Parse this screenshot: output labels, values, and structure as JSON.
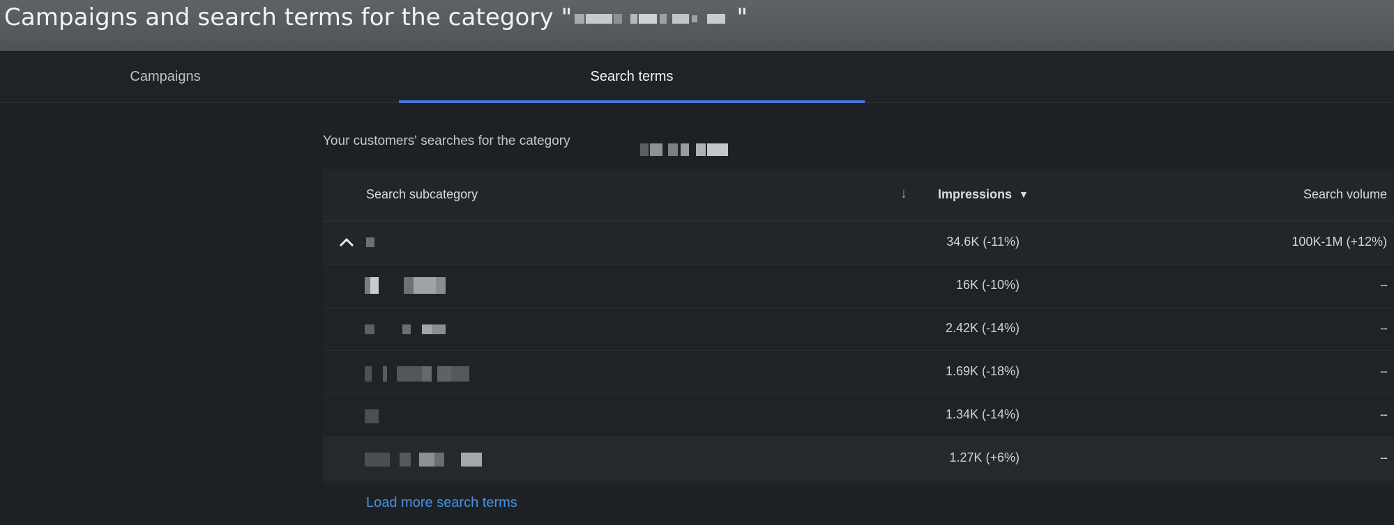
{
  "header": {
    "title_prefix": "Campaigns and search terms for the category \"",
    "title_suffix": "\""
  },
  "tabs": [
    {
      "label": "Campaigns",
      "active": false
    },
    {
      "label": "Search terms",
      "active": true
    }
  ],
  "subtitle": "Your customers' searches for the category",
  "table": {
    "columns": {
      "subcategory": "Search subcategory",
      "impressions": "Impressions",
      "volume": "Search volume"
    },
    "rows": [
      {
        "impressions": "34.6K (-11%)",
        "volume": "100K-1M (+12%)"
      },
      {
        "impressions": "16K (-10%)",
        "volume": "--"
      },
      {
        "impressions": "2.42K (-14%)",
        "volume": "--"
      },
      {
        "impressions": "1.69K (-18%)",
        "volume": "--"
      },
      {
        "impressions": "1.34K (-14%)",
        "volume": "--"
      },
      {
        "impressions": "1.27K (+6%)",
        "volume": "--"
      }
    ]
  },
  "load_more_label": "Load more search terms",
  "colors": {
    "accent": "#4374e0",
    "link": "#4a90e2",
    "background": "#1e2124"
  }
}
